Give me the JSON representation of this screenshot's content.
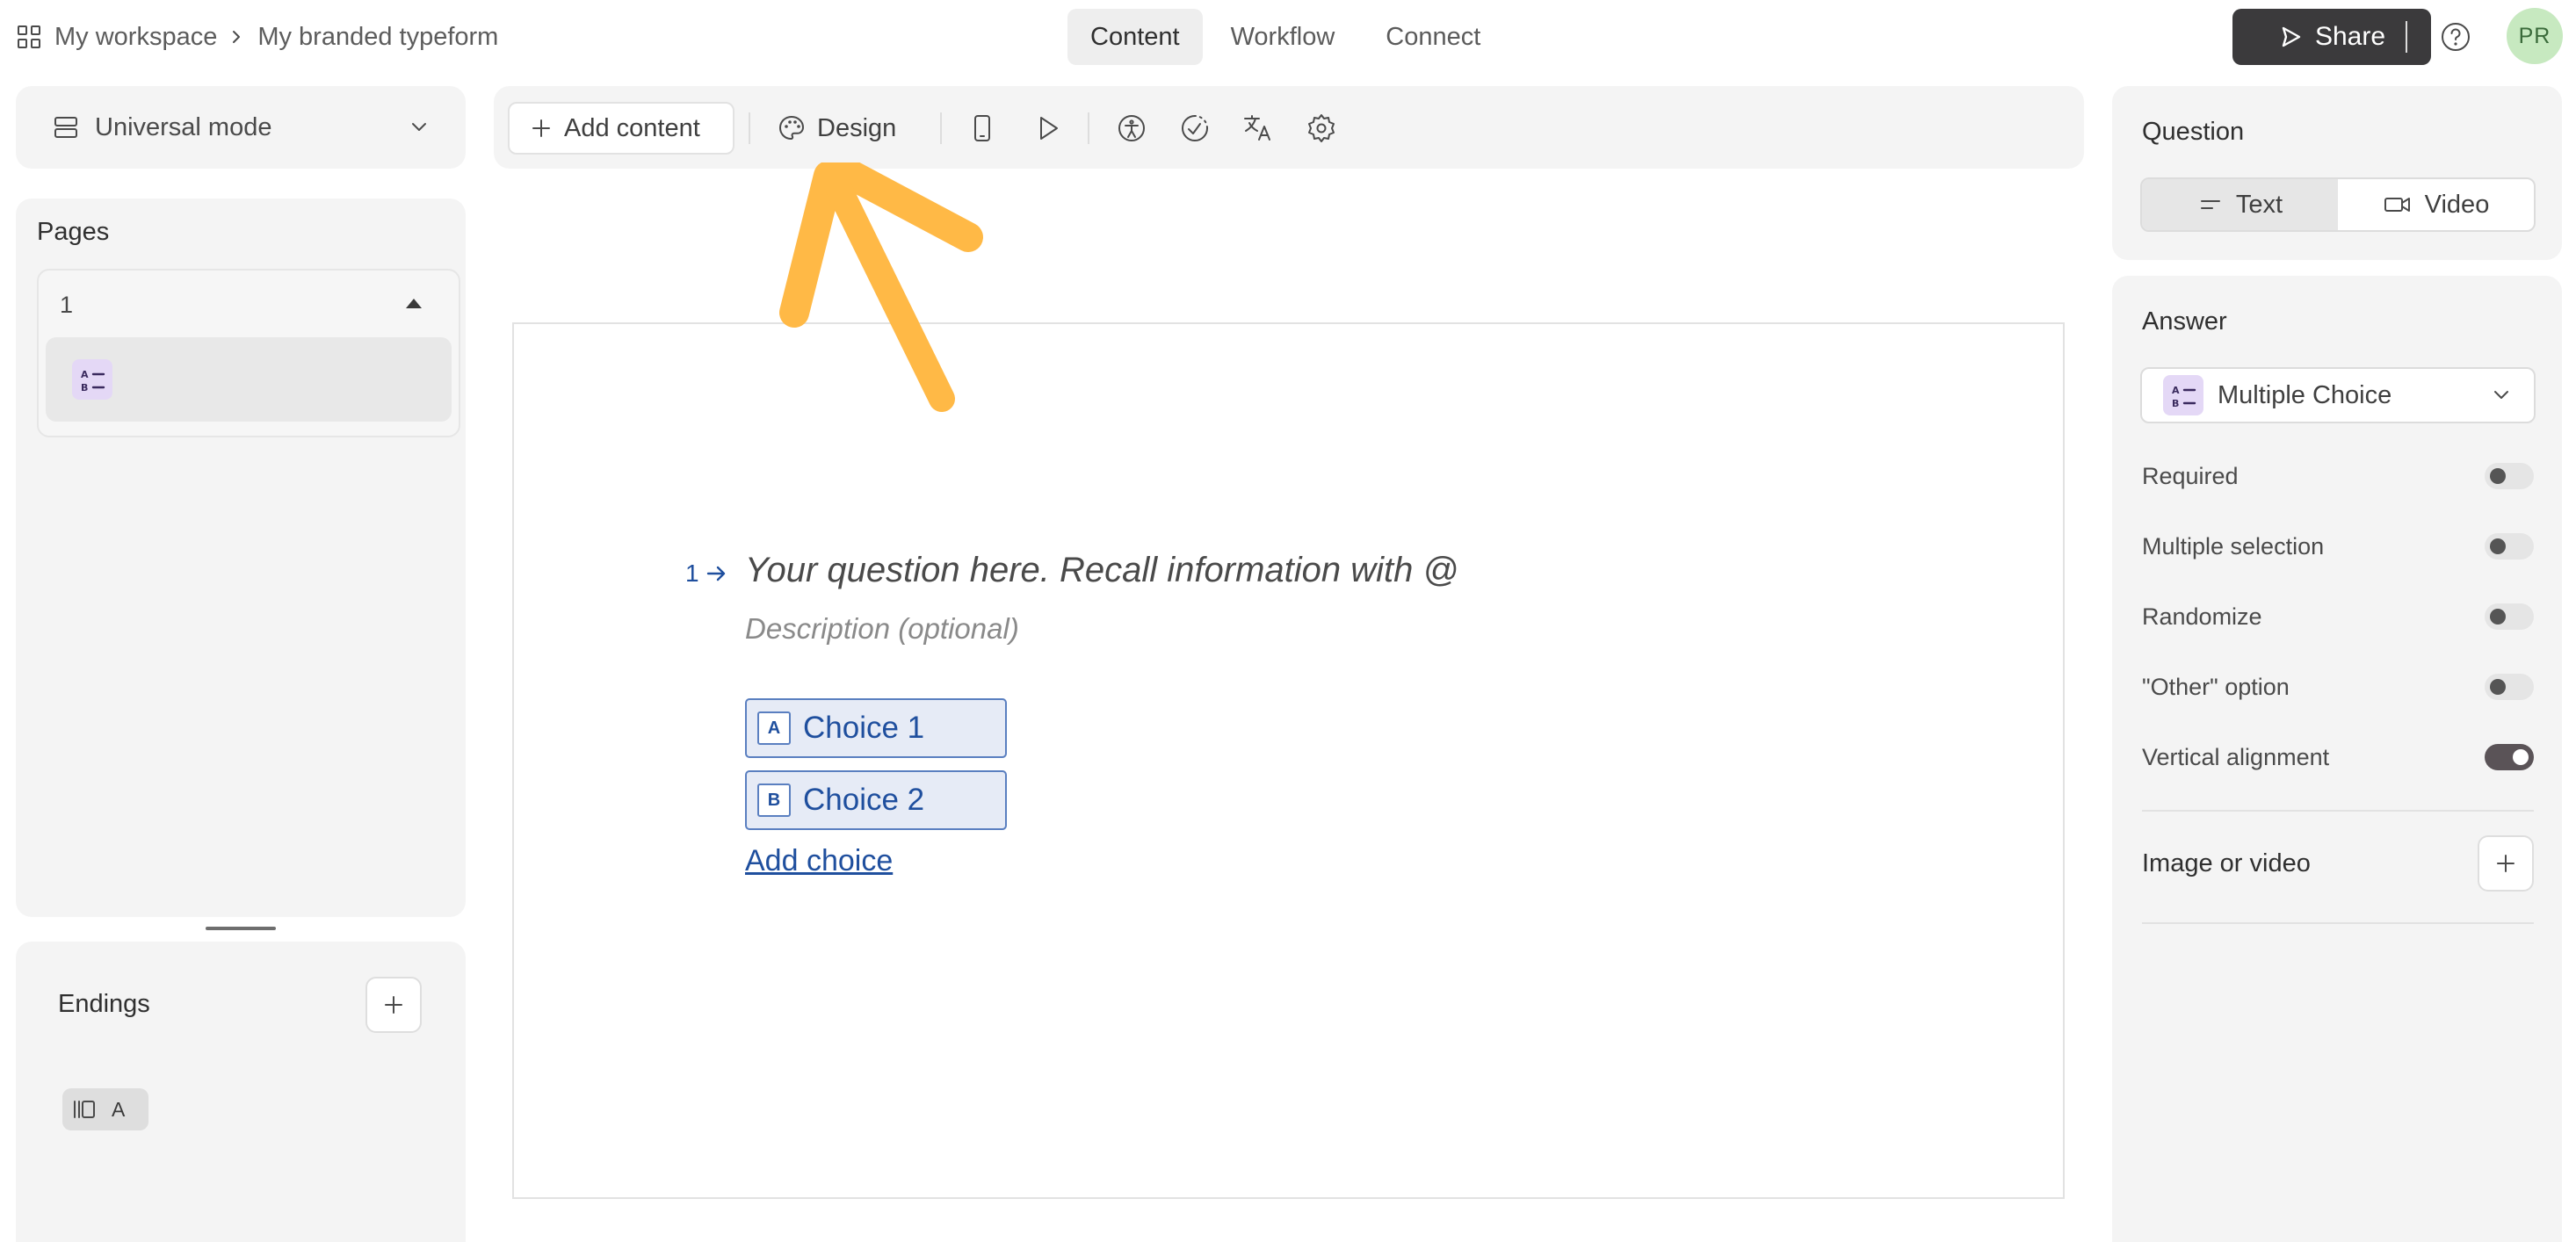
{
  "breadcrumb": {
    "workspace": "My workspace",
    "form": "My branded typeform"
  },
  "nav": {
    "tabs": [
      "Content",
      "Workflow",
      "Connect"
    ],
    "active": "Content"
  },
  "header": {
    "share_label": "Share",
    "avatar_initials": "PR"
  },
  "left": {
    "mode_label": "Universal mode",
    "pages_title": "Pages",
    "page_number": "1",
    "endings_title": "Endings",
    "ending_letter": "A"
  },
  "toolbar": {
    "add_content_label": "Add content",
    "design_label": "Design"
  },
  "question": {
    "number": "1",
    "title_placeholder": "Your question here. Recall information with @",
    "description_placeholder": "Description (optional)",
    "choices": [
      {
        "key": "A",
        "label": "Choice 1"
      },
      {
        "key": "B",
        "label": "Choice 2"
      }
    ],
    "add_choice_label": "Add choice"
  },
  "right": {
    "question_title": "Question",
    "question_types": [
      "Text",
      "Video"
    ],
    "question_type_selected": "Text",
    "answer_title": "Answer",
    "answer_type": "Multiple Choice",
    "options": [
      {
        "label": "Required",
        "on": false
      },
      {
        "label": "Multiple selection",
        "on": false
      },
      {
        "label": "Randomize",
        "on": false
      },
      {
        "label": "\"Other\" option",
        "on": false
      },
      {
        "label": "Vertical alignment",
        "on": true
      }
    ],
    "media_label": "Image or video"
  },
  "colors": {
    "accent_blue": "#1f4f9e",
    "arrow_orange": "#ffb946",
    "share_bg": "#3b3a3c",
    "avatar_bg": "#c7e9c0",
    "mc_badge": "#e4d8f6"
  },
  "icons": [
    "grid-icon",
    "chevron-right-icon",
    "send-icon",
    "help-icon",
    "layers-icon",
    "chevron-down-icon",
    "plus-icon",
    "palette-icon",
    "mobile-icon",
    "play-icon",
    "accessibility-icon",
    "loading-icon",
    "translate-icon",
    "gear-icon",
    "text-lines-icon",
    "video-icon",
    "multiple-choice-icon",
    "arrow-right-icon"
  ]
}
